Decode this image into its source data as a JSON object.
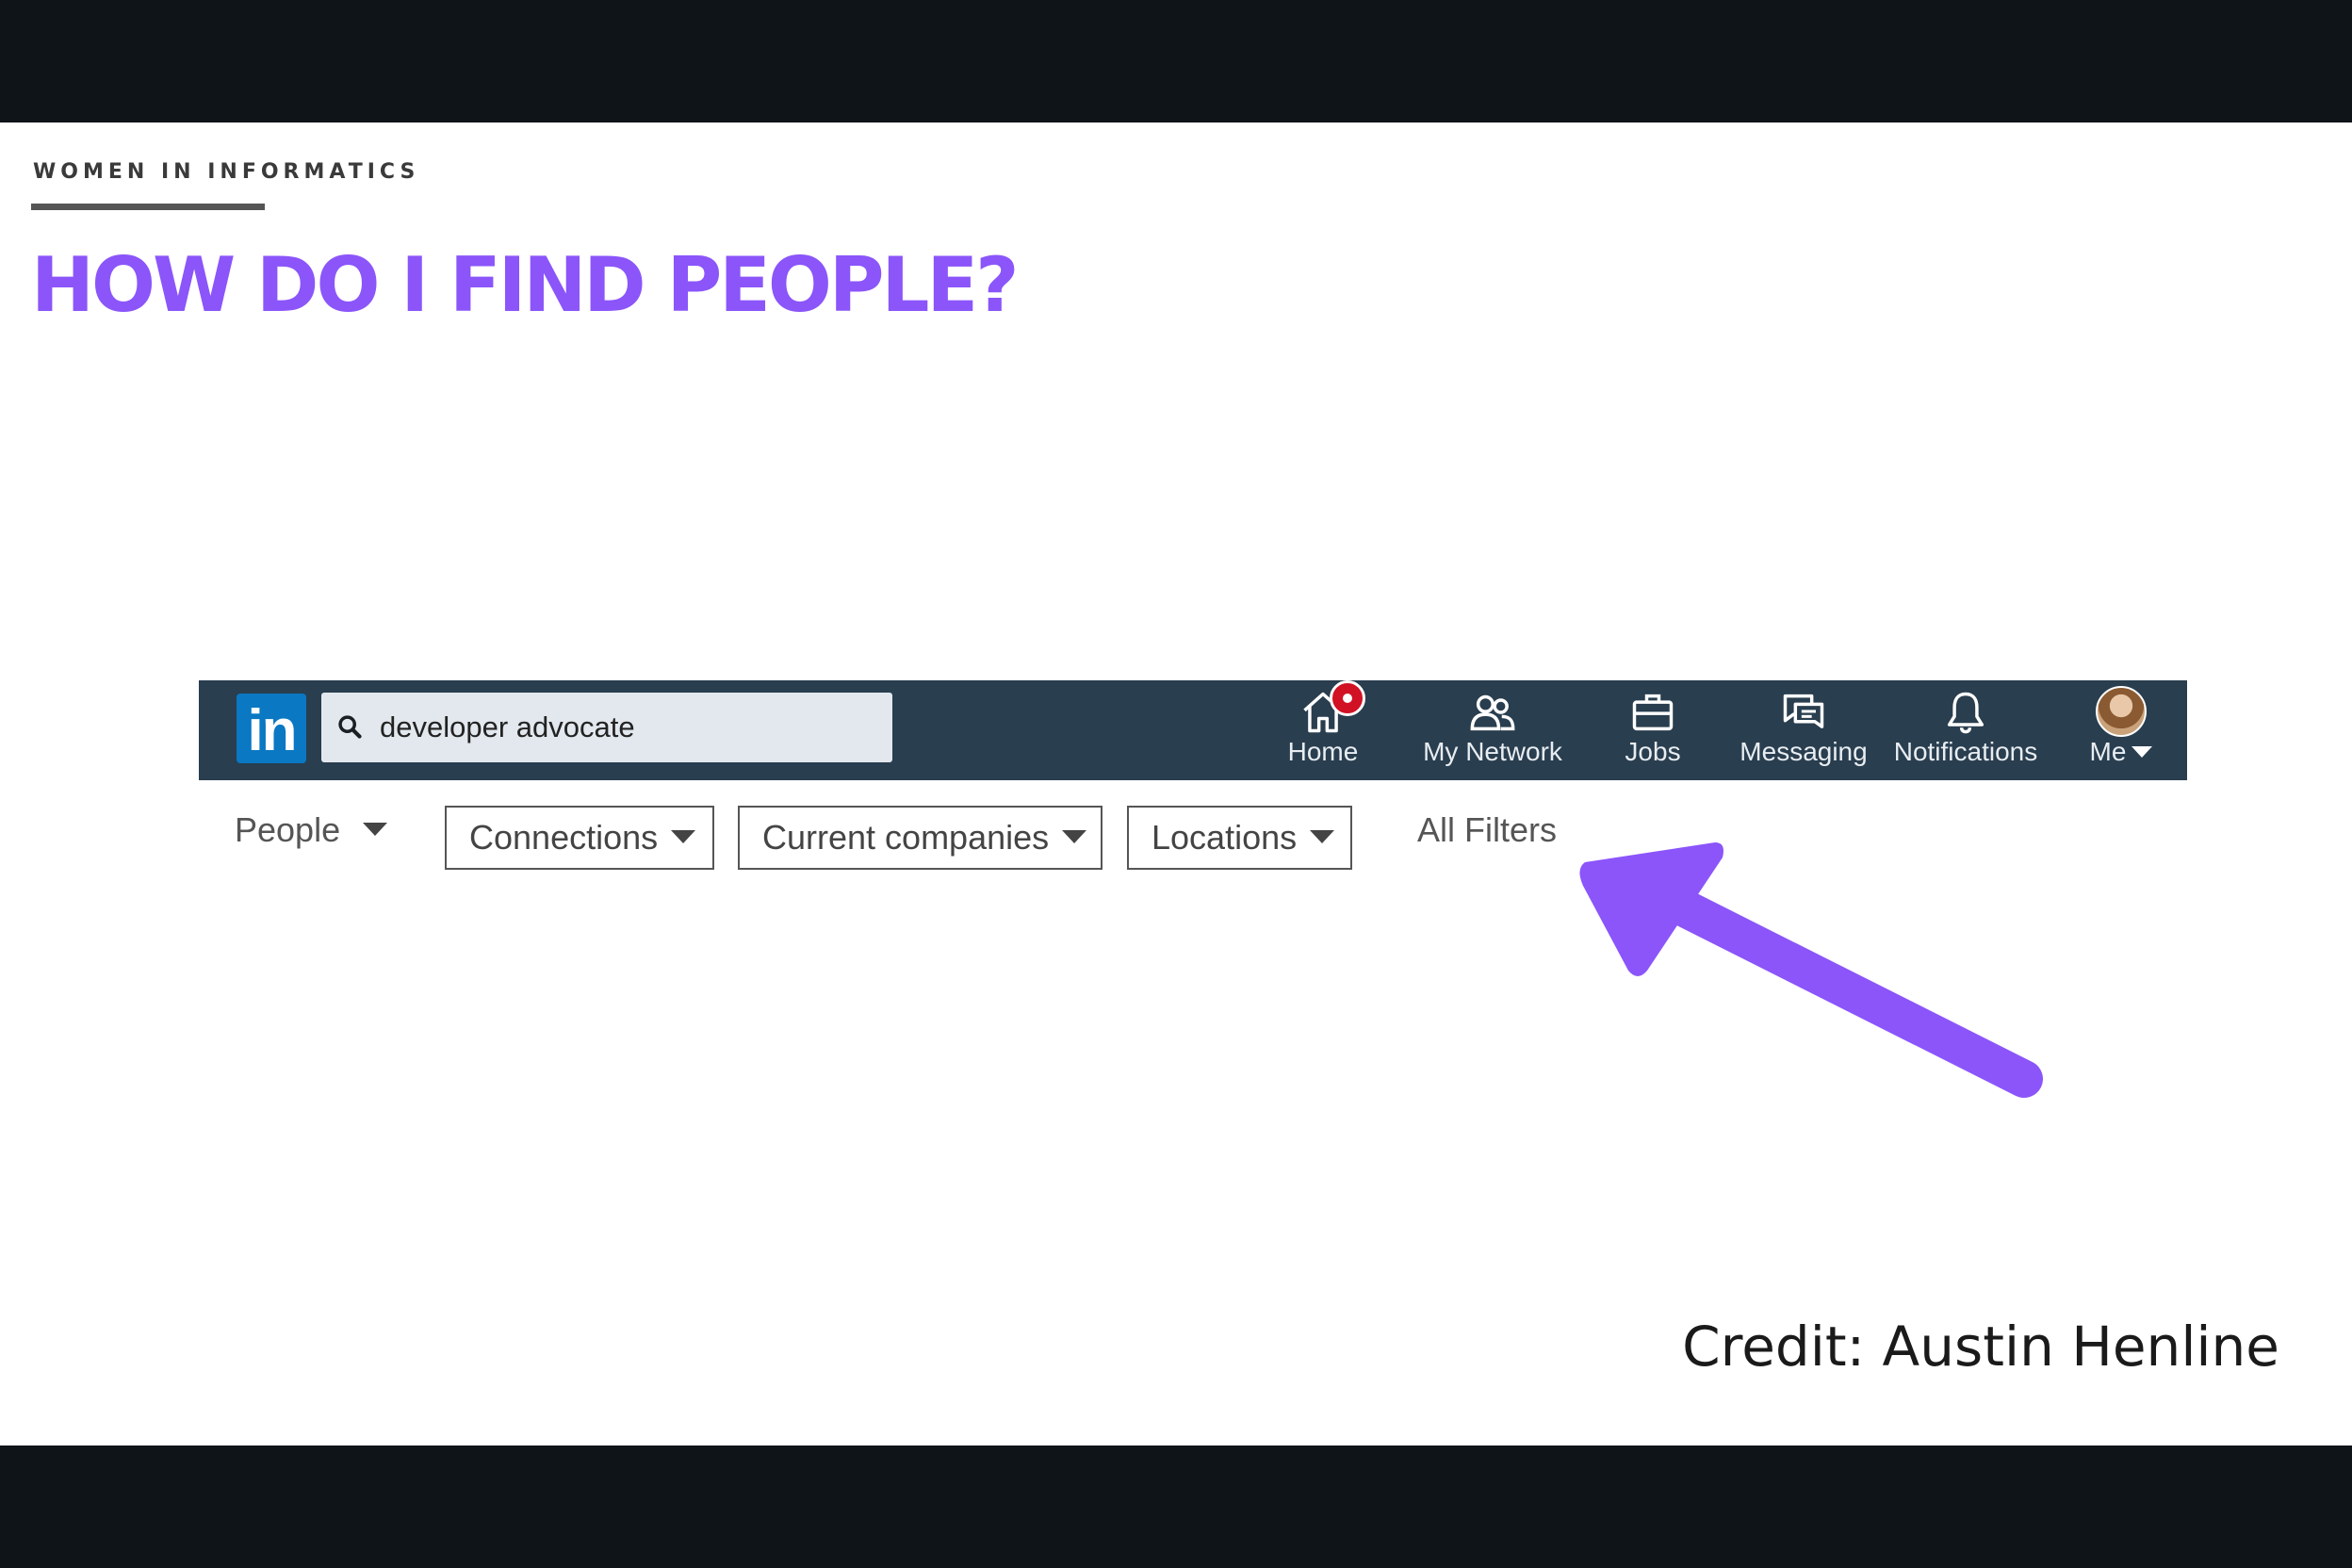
{
  "slide": {
    "kicker": "WOMEN IN INFORMATICS",
    "title": "HOW DO I FIND PEOPLE?",
    "credit": "Credit: Austin Henline",
    "accent_color": "#8b55fa"
  },
  "linkedin": {
    "logo_text": "in",
    "search_value": "developer advocate",
    "nav": [
      {
        "label": "Home",
        "icon": "home-icon",
        "has_badge": true
      },
      {
        "label": "My Network",
        "icon": "network-icon"
      },
      {
        "label": "Jobs",
        "icon": "briefcase-icon"
      },
      {
        "label": "Messaging",
        "icon": "messaging-icon"
      },
      {
        "label": "Notifications",
        "icon": "bell-icon"
      },
      {
        "label": "Me",
        "icon": "avatar"
      }
    ],
    "filters": {
      "people": "People",
      "connections": "Connections",
      "current_companies": "Current companies",
      "locations": "Locations",
      "all_filters": "All Filters"
    },
    "header_color": "#293e4f",
    "logo_color": "#0a78c2",
    "badge_color": "#d11124"
  }
}
